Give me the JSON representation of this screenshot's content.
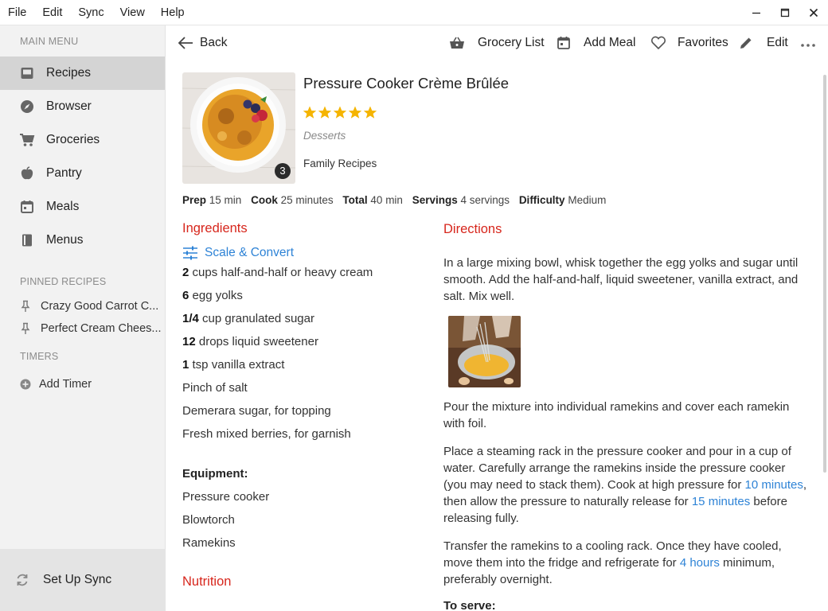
{
  "menubar": {
    "items": [
      "File",
      "Edit",
      "Sync",
      "View",
      "Help"
    ]
  },
  "sidebar": {
    "main_menu_label": "MAIN MENU",
    "items": [
      {
        "label": "Recipes",
        "icon": "inbox-icon",
        "active": true
      },
      {
        "label": "Browser",
        "icon": "compass-icon"
      },
      {
        "label": "Groceries",
        "icon": "cart-icon"
      },
      {
        "label": "Pantry",
        "icon": "apple-icon"
      },
      {
        "label": "Meals",
        "icon": "calendar-icon"
      },
      {
        "label": "Menus",
        "icon": "book-icon"
      }
    ],
    "pinned_label": "PINNED RECIPES",
    "pinned": [
      "Crazy Good Carrot C...",
      "Perfect Cream Chees..."
    ],
    "timers_label": "TIMERS",
    "add_timer": "Add Timer",
    "sync": "Set Up Sync"
  },
  "toolbar": {
    "back": "Back",
    "grocery_list": "Grocery List",
    "add_meal": "Add Meal",
    "favorites": "Favorites",
    "edit": "Edit"
  },
  "recipe": {
    "title": "Pressure Cooker Crème Brûlée",
    "rating": 5,
    "category": "Desserts",
    "collection": "Family Recipes",
    "photo_count": "3",
    "stats": [
      {
        "label": "Prep",
        "value": "15 min"
      },
      {
        "label": "Cook",
        "value": "25 minutes"
      },
      {
        "label": "Total",
        "value": "40 min"
      },
      {
        "label": "Servings",
        "value": "4 servings"
      },
      {
        "label": "Difficulty",
        "value": "Medium"
      }
    ]
  },
  "ingredients": {
    "heading": "Ingredients",
    "scale_convert": "Scale & Convert",
    "items": [
      {
        "qty": "2",
        "text": "cups half-and-half or heavy cream"
      },
      {
        "qty": "6",
        "text": "egg yolks"
      },
      {
        "qty": "1/4",
        "text": "cup granulated sugar"
      },
      {
        "qty": "12",
        "text": "drops liquid sweetener"
      },
      {
        "qty": "1",
        "text": "tsp vanilla extract"
      },
      {
        "qty": "",
        "text": "Pinch of salt"
      },
      {
        "qty": "",
        "text": "Demerara sugar, for topping"
      },
      {
        "qty": "",
        "text": "Fresh mixed berries, for garnish"
      }
    ],
    "equipment_heading": "Equipment:",
    "equipment": [
      "Pressure cooker",
      "Blowtorch",
      "Ramekins"
    ],
    "nutrition_heading": "Nutrition"
  },
  "directions": {
    "heading": "Directions",
    "step1": "In a large mixing bowl, whisk together the egg yolks and sugar until smooth. Add the half-and-half, liquid sweetener, vanilla extract, and salt. Mix well.",
    "step2": "Pour the mixture into individual ramekins and cover each ramekin with foil.",
    "step3_a": "Place a steaming rack in the pressure cooker and pour in a cup of water. Carefully arrange the ramekins inside the pressure cooker (you may need to stack them). Cook at high pressure for ",
    "step3_link1": "10 minutes",
    "step3_b": ", then allow the pressure to naturally release for ",
    "step3_link2": "15 minutes",
    "step3_c": " before releasing fully.",
    "step4_a": "Transfer the ramekins to a cooling rack. Once they have cooled, move them into the fridge and refrigerate for ",
    "step4_link": "4 hours",
    "step4_b": " minimum, preferably overnight.",
    "to_serve": "To serve:"
  },
  "colors": {
    "accent_red": "#d7261c",
    "link_blue": "#2e83d6",
    "star": "#f5b400",
    "sidebar_bg": "#f2f2f2",
    "active_bg": "#d4d4d4"
  }
}
